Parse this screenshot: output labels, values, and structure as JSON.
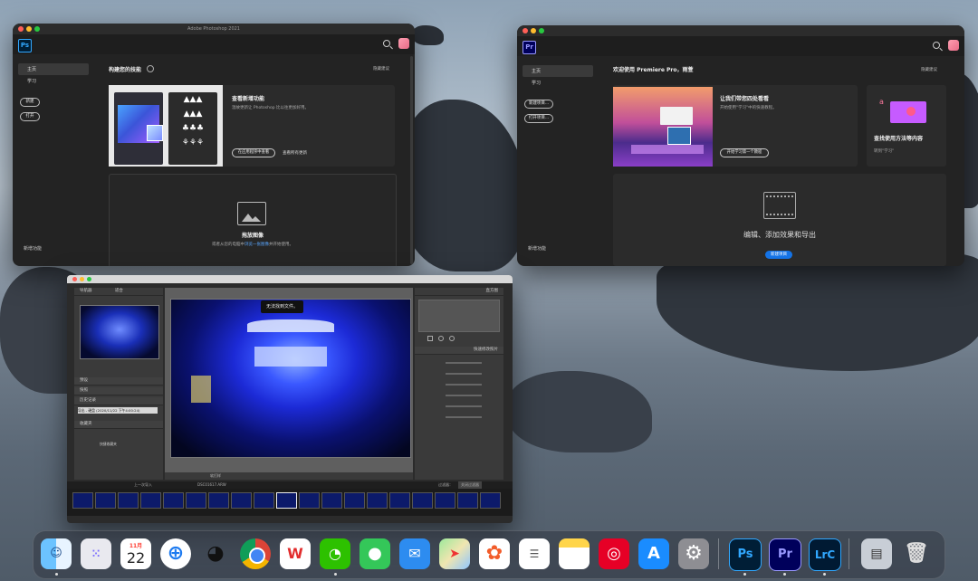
{
  "photoshop": {
    "badge": "Ps",
    "window_title": "Adobe Photoshop 2021",
    "sidebar": {
      "home": "主页",
      "learn": "学习",
      "new_btn": "新建",
      "open_btn": "打开",
      "whats_new": "新增功能"
    },
    "section_title": "构建您的技能",
    "hide_tips": "隐藏建议",
    "card_title": "查看新增功能",
    "card_desc": "温故更新让 Photoshop 比以往更加好用。",
    "card_btn": "在应用程序中查看",
    "card_link": "查看所有更新",
    "drop_title": "拖放图像",
    "drop_desc_a": "或者从您的电脑中",
    "drop_desc_link": "浏览一张图像",
    "drop_desc_b": "并开始使用。"
  },
  "premiere": {
    "badge": "Pr",
    "sidebar": {
      "home": "主页",
      "learn": "学习",
      "new_btn": "新建项目...",
      "open_btn": "打开项目...",
      "whats_new": "新增功能"
    },
    "section_title": "欢迎使用 Premiere Pro，雨萱",
    "hide_tips": "隐藏建议",
    "card_title": "让我们带您四处看看",
    "card_desc": "开始使用\"学习\"中的快速教程。",
    "card_btn": "开始学习第一个教程",
    "card2_title": "查找使用方法等内容",
    "card2_desc": "转到\"学习\"",
    "edit_title": "编辑、添加效果和导出",
    "new_project_btn": "新建项目"
  },
  "lightroom": {
    "navigator": "导航器",
    "zoom_opts": [
      "适合",
      "100%",
      "200%"
    ],
    "histogram": "直方图",
    "panels": [
      "预设",
      "快照",
      "历史记录",
      "收藏夹"
    ],
    "history_item": "导出 - 硬盘 (2020/11/22 下午4:00:24)",
    "collection_item": "快捷收藏夹",
    "toast": "无法找到文件。",
    "quick_develop": "快速修改照片",
    "soft_proof": "软打样",
    "filter_label": "过滤器：",
    "filter_value": "关闭过滤器",
    "filmstrip_info": "上一次导入",
    "filmstrip_file": "DSC01617.ARW"
  },
  "dock": {
    "calendar_month": "11月",
    "calendar_day": "22",
    "ps": "Ps",
    "pr": "Pr",
    "lrc": "LrC"
  }
}
